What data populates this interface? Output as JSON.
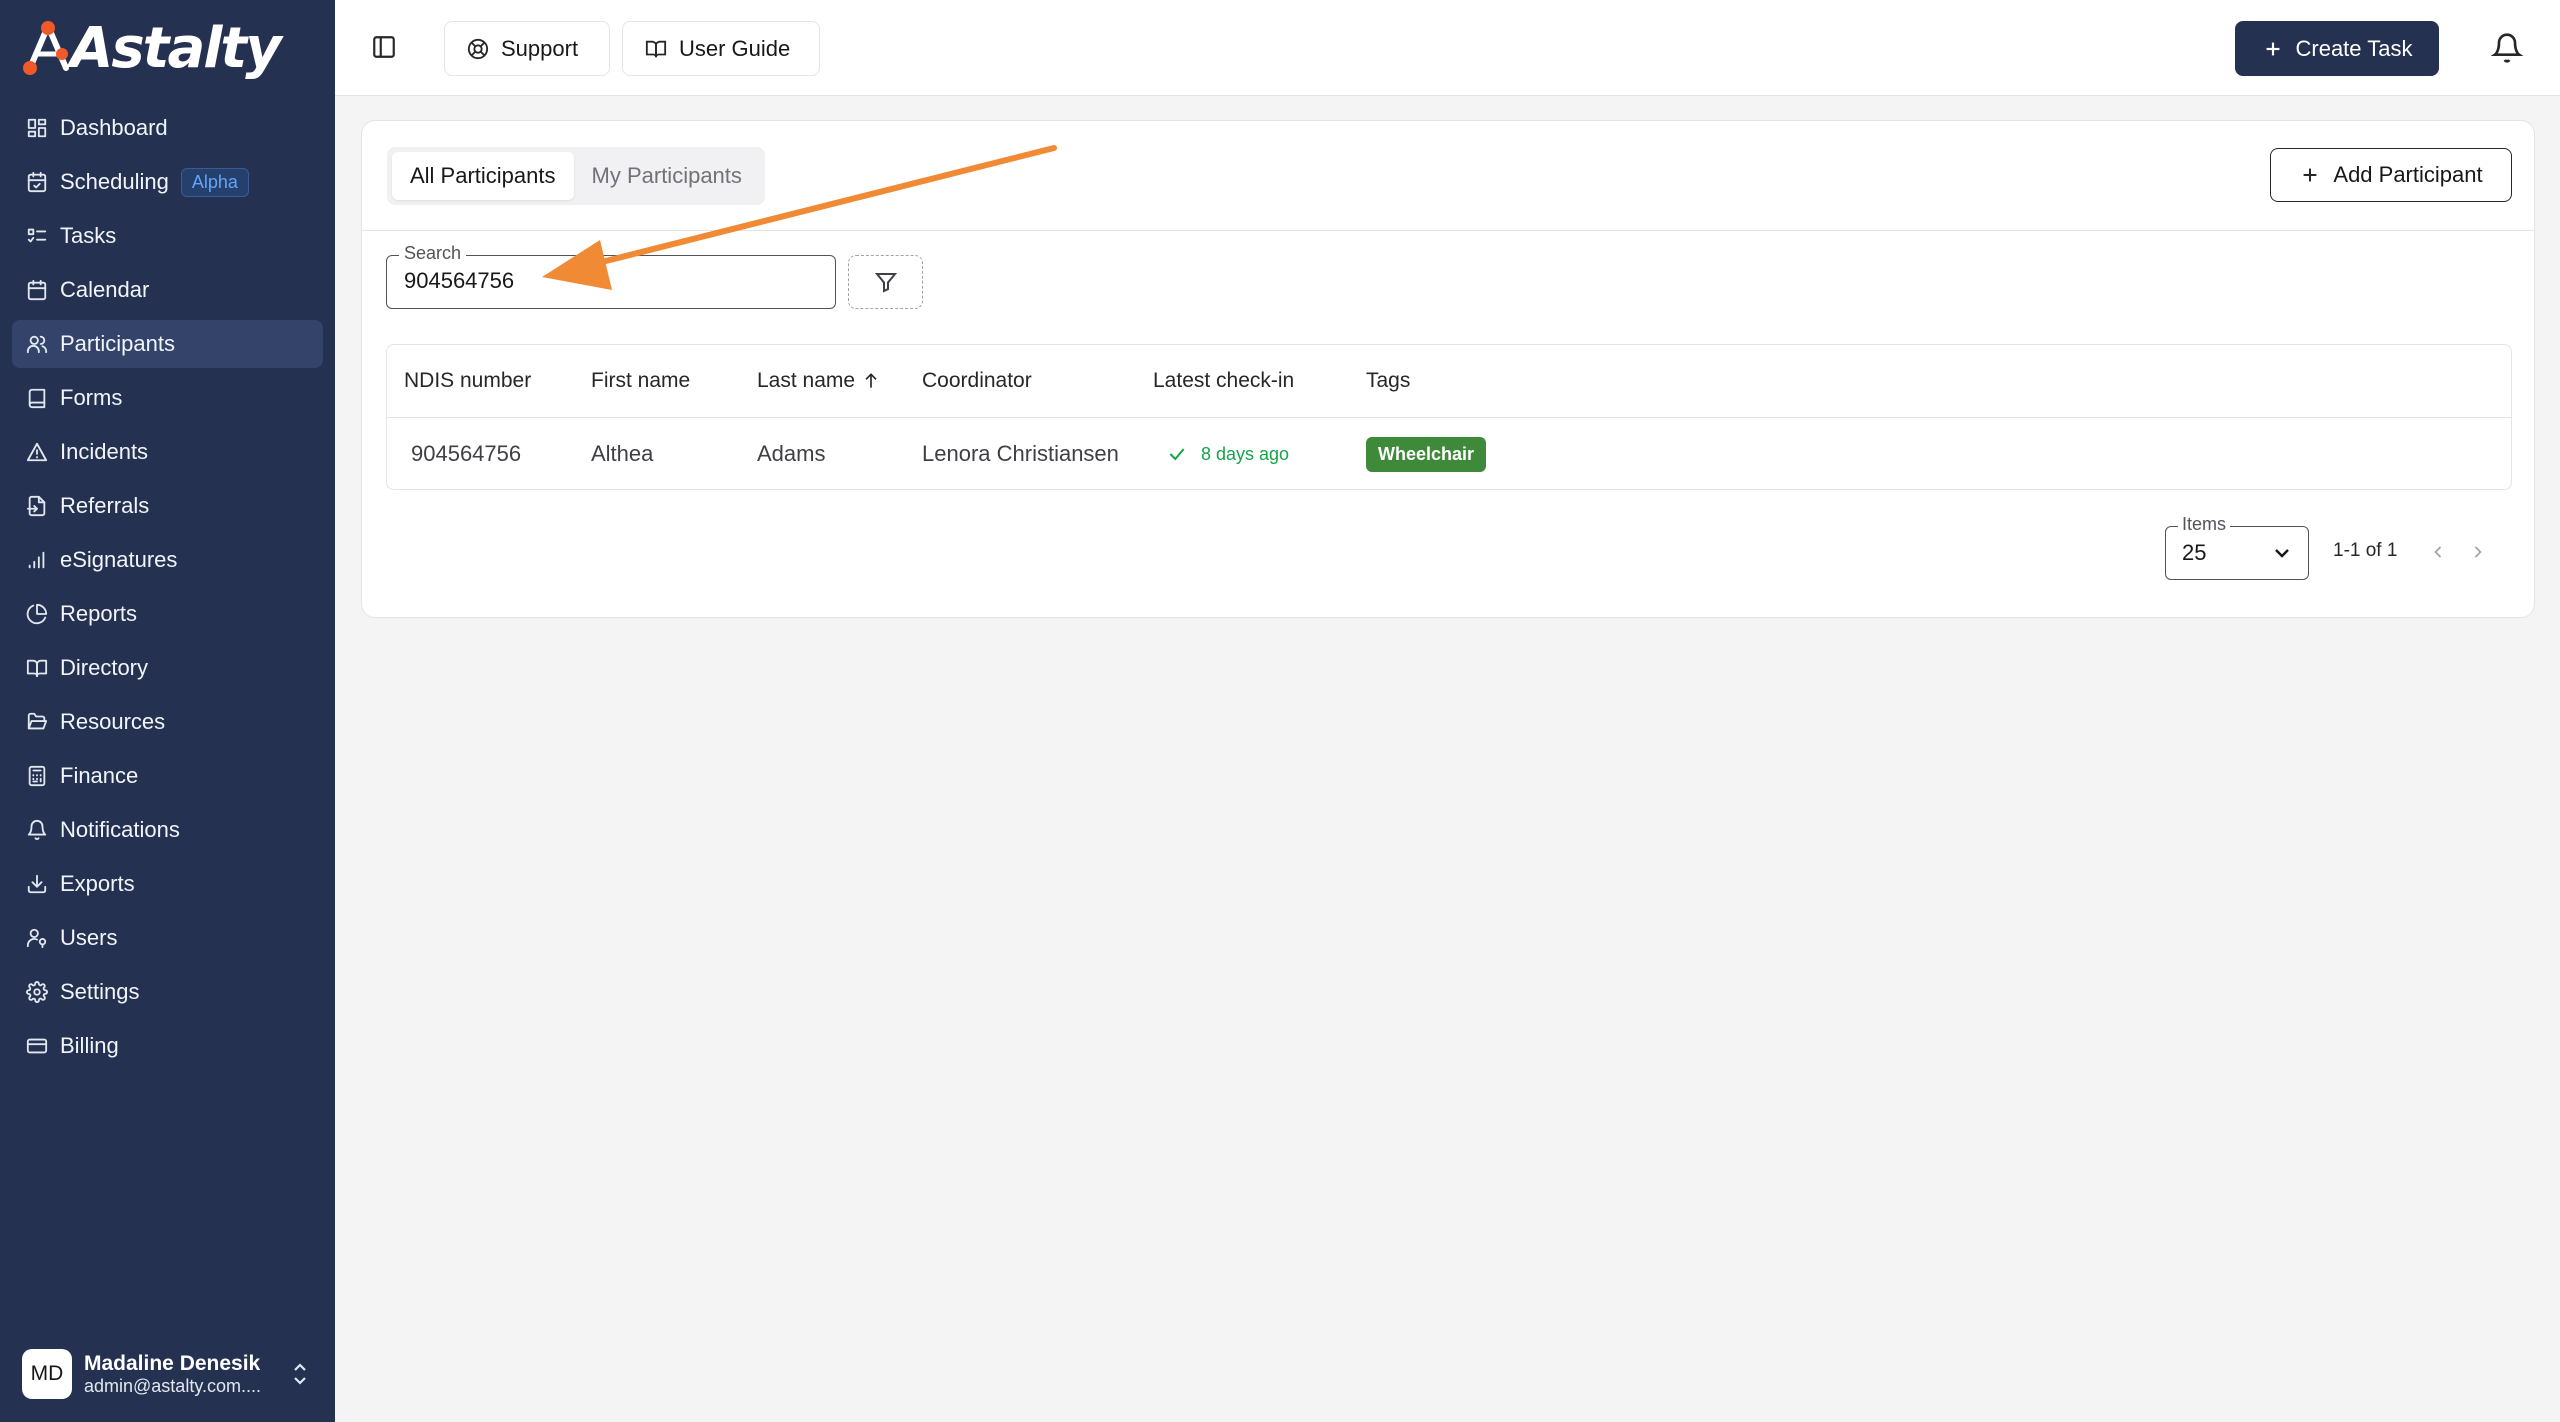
{
  "app": {
    "brand": "Astalty",
    "accent": "#243151",
    "arrow_color": "#f08a34"
  },
  "sidebar": {
    "items": [
      {
        "label": "Dashboard",
        "icon": "dashboard-icon"
      },
      {
        "label": "Scheduling",
        "icon": "calendar-check-icon",
        "badge": "Alpha"
      },
      {
        "label": "Tasks",
        "icon": "list-todo-icon"
      },
      {
        "label": "Calendar",
        "icon": "calendar-icon"
      },
      {
        "label": "Participants",
        "icon": "users-icon",
        "active": true
      },
      {
        "label": "Forms",
        "icon": "book-icon"
      },
      {
        "label": "Incidents",
        "icon": "warning-triangle-icon"
      },
      {
        "label": "Referrals",
        "icon": "file-import-icon"
      },
      {
        "label": "eSignatures",
        "icon": "signal-bars-icon"
      },
      {
        "label": "Reports",
        "icon": "pie-chart-icon"
      },
      {
        "label": "Directory",
        "icon": "open-book-icon"
      },
      {
        "label": "Resources",
        "icon": "folder-open-icon"
      },
      {
        "label": "Finance",
        "icon": "calculator-icon"
      },
      {
        "label": "Notifications",
        "icon": "bell-icon"
      },
      {
        "label": "Exports",
        "icon": "download-icon"
      },
      {
        "label": "Users",
        "icon": "user-key-icon"
      },
      {
        "label": "Settings",
        "icon": "gear-icon"
      },
      {
        "label": "Billing",
        "icon": "credit-card-icon"
      }
    ],
    "user": {
      "initials": "MD",
      "name": "Madaline Denesik",
      "email": "admin@astalty.com...."
    }
  },
  "topbar": {
    "support_label": "Support",
    "guide_label": "User Guide",
    "create_label": "Create Task"
  },
  "main": {
    "tabs": [
      {
        "label": "All Participants",
        "active": true
      },
      {
        "label": "My Participants",
        "active": false
      }
    ],
    "add_label": "Add Participant",
    "search": {
      "label": "Search",
      "value": "904564756"
    },
    "table": {
      "columns": [
        "NDIS number",
        "First name",
        "Last name",
        "Coordinator",
        "Latest check-in",
        "Tags"
      ],
      "sorted_column": "Last name",
      "sort_direction": "ascending",
      "rows": [
        {
          "ndis": "904564756",
          "first": "Althea",
          "last": "Adams",
          "coordinator": "Lenora Christiansen",
          "checkin": "8 days ago",
          "tag": "Wheelchair"
        }
      ]
    },
    "pagination": {
      "items_label": "Items",
      "items_value": "25",
      "range": "1-1 of 1"
    }
  }
}
